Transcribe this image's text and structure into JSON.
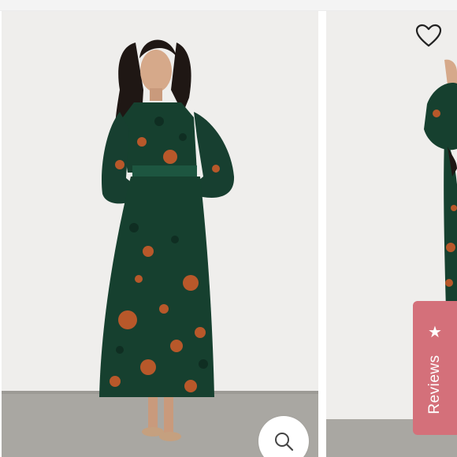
{
  "gallery": {
    "images": [
      {
        "alt": "",
        "icon": "model-photo-dress-front"
      },
      {
        "alt": "",
        "icon": "model-photo-dress-side"
      }
    ],
    "wishlist_icon": "heart-outline-icon",
    "zoom_icon": "magnifier-icon"
  },
  "reviews_tab": {
    "label": "Reviews",
    "icon": "star-icon",
    "color": "#d4707a"
  },
  "colors": {
    "dress_green": "#16402f",
    "floral_orange": "#b8582a",
    "background": "#efeeec",
    "floor": "#a9a7a2"
  }
}
